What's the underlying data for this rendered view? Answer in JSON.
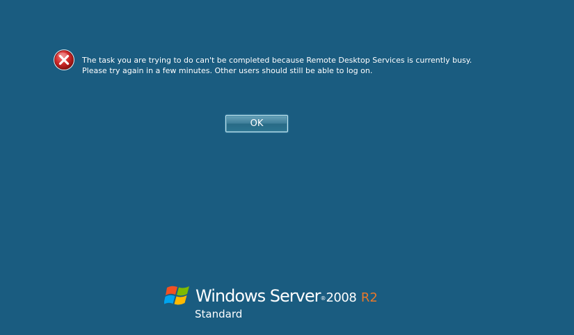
{
  "error": {
    "icon": "error-x-icon",
    "line1": "The task you are trying to do can't be completed because Remote Desktop Services is currently busy.",
    "line2": "Please try again in a few minutes. Other users should still be able to log on."
  },
  "buttons": {
    "ok_label": "OK"
  },
  "branding": {
    "logo_icon": "windows-flag-icon",
    "product": "Windows Server",
    "trademark": "®",
    "version": "2008",
    "release": "R2",
    "edition": "Standard"
  },
  "colors": {
    "background": "#1a5c80",
    "error_red": "#d12a2a",
    "release_orange": "#e8782a",
    "text": "#ffffff"
  }
}
